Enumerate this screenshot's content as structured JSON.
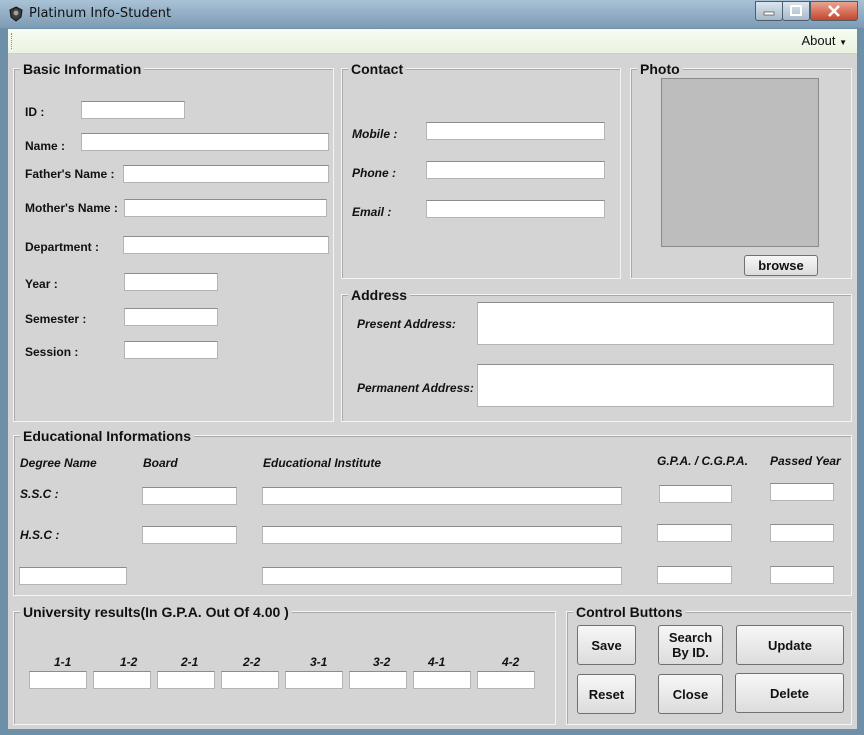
{
  "window": {
    "title": "Platinum Info-Student"
  },
  "menu": {
    "about": "About"
  },
  "basic": {
    "title": "Basic Information",
    "id": "ID :",
    "name": "Name :",
    "father": "Father's Name :",
    "mother": "Mother's Name :",
    "department": "Department :",
    "year": "Year :",
    "semester": "Semester :",
    "session": "Session :"
  },
  "contact": {
    "title": "Contact",
    "mobile": "Mobile :",
    "phone": "Phone :",
    "email": "Email :"
  },
  "photo": {
    "title": "Photo",
    "browse": "browse"
  },
  "address": {
    "title": "Address",
    "present": "Present Address:",
    "permanent": "Permanent Address:"
  },
  "edu": {
    "title": "Educational Informations",
    "headers": {
      "degree": "Degree Name",
      "board": "Board",
      "institute": "Educational Institute",
      "gpa": "G.P.A. / C.G.P.A.",
      "year": "Passed Year"
    },
    "ssc": "S.S.C :",
    "hsc": "H.S.C :"
  },
  "uni": {
    "title": "University results(In G.P.A. Out Of 4.00 )",
    "terms": [
      "1-1",
      "1-2",
      "2-1",
      "2-2",
      "3-1",
      "3-2",
      "4-1",
      "4-2"
    ]
  },
  "controls": {
    "title": "Control Buttons",
    "save": "Save",
    "search": "Search By ID.",
    "update": "Update",
    "reset": "Reset",
    "close": "Close",
    "delete": "Delete"
  }
}
